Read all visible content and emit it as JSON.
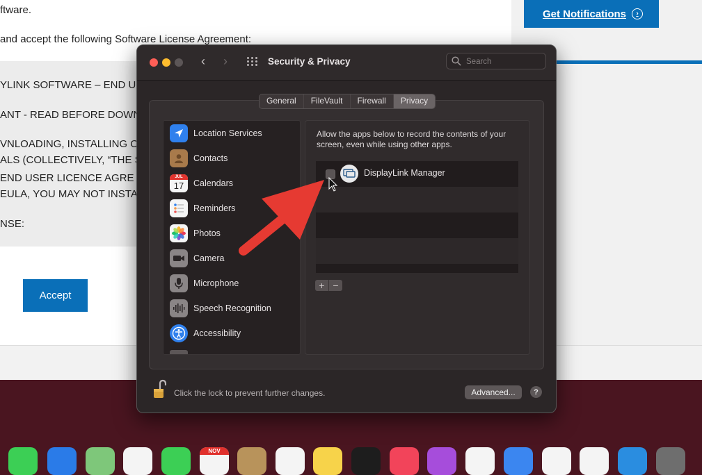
{
  "webpage": {
    "text_lines": [
      "ftware.",
      "and accept the following Software License Agreement:",
      "YLINK SOFTWARE – END US",
      "ANT - READ BEFORE DOWN",
      "VNLOADING, INSTALLING OF",
      "ALS (COLLECTIVELY, “THE S",
      " END USER LICENCE AGRE",
      " EULA, YOU MAY NOT INSTA",
      "NSE:"
    ],
    "notify_label": "Get Notifications",
    "accept_label": "Accept",
    "accent_color": "#0a6fb8"
  },
  "window": {
    "title": "Security & Privacy",
    "search_placeholder": "Search",
    "tabs": [
      {
        "label": "General",
        "active": false
      },
      {
        "label": "FileVault",
        "active": false
      },
      {
        "label": "Firewall",
        "active": false
      },
      {
        "label": "Privacy",
        "active": true
      }
    ],
    "sidebar_items": [
      {
        "label": "Location Services",
        "icon": "location-icon"
      },
      {
        "label": "Contacts",
        "icon": "contacts-icon"
      },
      {
        "label": "Calendars",
        "icon": "calendar-icon"
      },
      {
        "label": "Reminders",
        "icon": "reminders-icon"
      },
      {
        "label": "Photos",
        "icon": "photos-icon"
      },
      {
        "label": "Camera",
        "icon": "camera-icon"
      },
      {
        "label": "Microphone",
        "icon": "microphone-icon"
      },
      {
        "label": "Speech Recognition",
        "icon": "speech-recognition-icon"
      },
      {
        "label": "Accessibility",
        "icon": "accessibility-icon"
      }
    ],
    "calendar_icon": {
      "month": "JUL",
      "day": "17"
    },
    "pane_description": "Allow the apps below to record the contents of your screen, even while using other apps.",
    "apps": [
      {
        "name": "DisplayLink Manager",
        "checked": false,
        "icon": "displaylink-icon"
      }
    ],
    "add_label": "+",
    "remove_label": "−",
    "lock_text": "Click the lock to prevent further changes.",
    "advanced_label": "Advanced...",
    "help_label": "?"
  },
  "dock": {
    "calendar_month": "NOV"
  }
}
